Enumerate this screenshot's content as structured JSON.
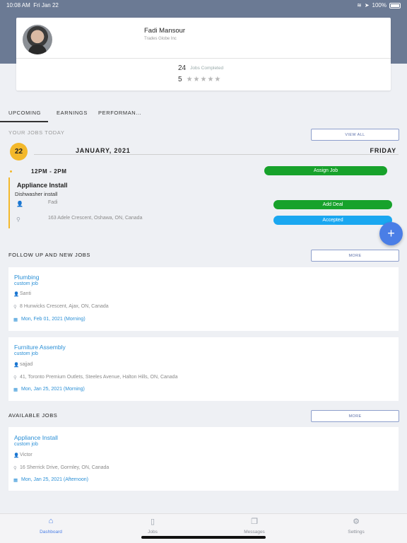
{
  "status_bar": {
    "time": "10:08 AM",
    "date": "Fri Jan 22",
    "battery": "100%"
  },
  "profile": {
    "name": "Fadi Mansour",
    "company": "Trades Globe Inc",
    "jobs_completed_count": "24",
    "jobs_completed_label": "Jobs Completed",
    "rating": "5",
    "stars": "★★★★★"
  },
  "tabs": [
    "UPCOMING",
    "EARNINGS",
    "PERFORMAN..."
  ],
  "today": {
    "section_label": "YOUR JOBS TODAY",
    "view_all": "VIEW ALL",
    "day_number": "22",
    "date": "JANUARY, 2021",
    "weekday": "FRIDAY",
    "time_range": "12PM - 2PM",
    "job_title": "Appliance Install",
    "job_sub": "Dishwasher install",
    "person": "Fadi",
    "address": "163 Adele Crescent, Oshawa, ON, Canada",
    "assign_job": "Assign Job",
    "add_deal": "Add Deal",
    "accepted": "Accepted"
  },
  "follow_up": {
    "section_label": "FOLLOW UP AND NEW JOBS",
    "more": "MORE",
    "jobs": [
      {
        "title": "Plumbing",
        "type": "custom job",
        "person": "Santi",
        "address": "8 Hunwicks Crescent, Ajax, ON, Canada",
        "date": "Mon, Feb 01, 2021 (Morning)"
      },
      {
        "title": "Furniture Assembly",
        "type": "custom job",
        "person": "sajjad",
        "address": "41, Toronto Premium Outlets, Steeles Avenue, Halton Hills, ON, Canada",
        "date": "Mon, Jan 25, 2021 (Morning)"
      }
    ]
  },
  "available": {
    "section_label": "AVAILABLE JOBS",
    "more": "MORE",
    "jobs": [
      {
        "title": "Appliance Install",
        "type": "custom job",
        "person": "Victor",
        "address": "16 Sherrick Drive, Gormley, ON, Canada",
        "date": "Mon, Jan 25, 2021 (Afternoon)"
      }
    ]
  },
  "nav": [
    {
      "label": "Dashboard",
      "icon": "home-icon"
    },
    {
      "label": "Jobs",
      "icon": "jobs-icon"
    },
    {
      "label": "Messages",
      "icon": "messages-icon"
    },
    {
      "label": "Settings",
      "icon": "settings-icon"
    }
  ],
  "colors": {
    "accent": "#4a7ee6",
    "header": "#6b7a94",
    "date_badge": "#f3b82b",
    "green": "#17a22b",
    "blue": "#1aa7f0",
    "link": "#2a8fd6"
  }
}
